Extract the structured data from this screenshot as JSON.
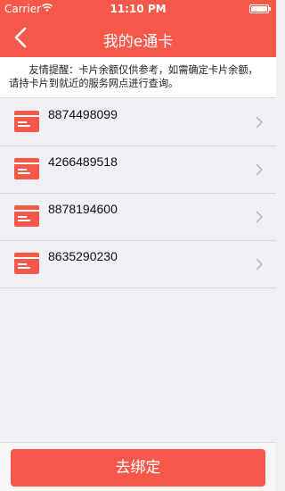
{
  "status_bar": {
    "carrier": "Carrier",
    "time": "11:10 PM",
    "wifi_icon": "wifi-icon",
    "battery_icon": "battery-icon"
  },
  "nav": {
    "back_icon": "chevron-left-icon",
    "title": "我的e通卡"
  },
  "notice": {
    "text": "友情提醒：卡片余额仅供参考，如需确定卡片余额，请持卡片到就近的服务网点进行查询。"
  },
  "cards": [
    {
      "number": "8874498099",
      "icon": "card-icon"
    },
    {
      "number": "4266489518",
      "icon": "card-icon"
    },
    {
      "number": "8878194600",
      "icon": "card-icon"
    },
    {
      "number": "8635290230",
      "icon": "card-icon"
    }
  ],
  "bottom": {
    "bind_button_label": "去绑定"
  },
  "colors": {
    "accent": "#f6594a",
    "background": "#efeff4"
  }
}
